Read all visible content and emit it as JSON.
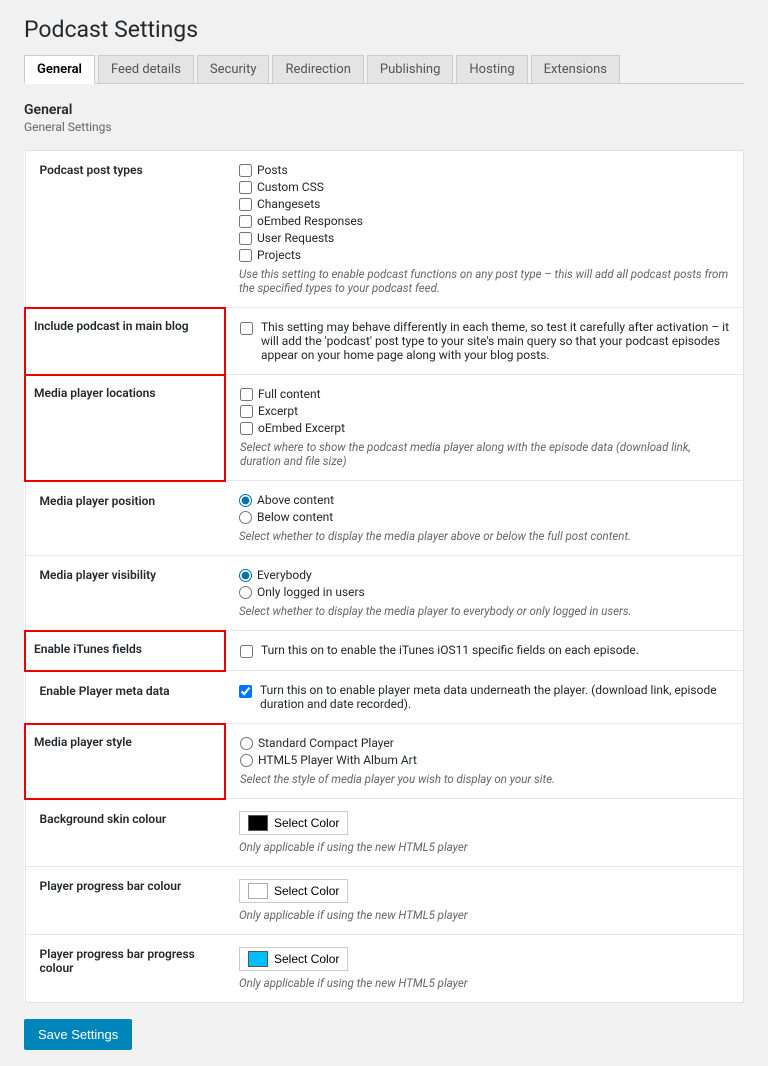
{
  "page": {
    "title": "Podcast Settings",
    "tabs": [
      {
        "label": "General",
        "active": true
      },
      {
        "label": "Feed details",
        "active": false
      },
      {
        "label": "Security",
        "active": false
      },
      {
        "label": "Redirection",
        "active": false
      },
      {
        "label": "Publishing",
        "active": false
      },
      {
        "label": "Hosting",
        "active": false
      },
      {
        "label": "Extensions",
        "active": false
      }
    ]
  },
  "section": {
    "title": "General",
    "subtitle": "General Settings"
  },
  "settings": {
    "podcast_post_types": {
      "label": "Podcast post types",
      "options": [
        "Posts",
        "Custom CSS",
        "Changesets",
        "oEmbed Responses",
        "User Requests",
        "Projects"
      ],
      "help": "Use this setting to enable podcast functions on any post type – this will add all podcast posts from the specified types to your podcast feed."
    },
    "include_podcast": {
      "label": "Include podcast in main blog",
      "help_text": "This setting may behave differently in each theme, so test it carefully after activation – it will add the 'podcast' post type to your site's main query so that your podcast episodes appear on your home page along with your blog posts.",
      "highlighted": true
    },
    "media_player_locations": {
      "label": "Media player locations",
      "options": [
        "Full content",
        "Excerpt",
        "oEmbed Excerpt"
      ],
      "help": "Select where to show the podcast media player along with the episode data (download link, duration and file size)",
      "highlighted": true
    },
    "media_player_position": {
      "label": "Media player position",
      "options": [
        "Above content",
        "Below content"
      ],
      "selected": "Above content",
      "help": "Select whether to display the media player above or below the full post content."
    },
    "media_player_visibility": {
      "label": "Media player visibility",
      "options": [
        "Everybody",
        "Only logged in users"
      ],
      "selected": "Everybody",
      "help": "Select whether to display the media player to everybody or only logged in users."
    },
    "enable_itunes": {
      "label": "Enable iTunes fields",
      "help_text": "Turn this on to enable the iTunes iOS11 specific fields on each episode.",
      "highlighted": true
    },
    "enable_player_meta": {
      "label": "Enable Player meta data",
      "help_text": "Turn this on to enable player meta data underneath the player. (download link, episode duration and date recorded).",
      "checked": true
    },
    "media_player_style": {
      "label": "Media player style",
      "options": [
        "Standard Compact Player",
        "HTML5 Player With Album Art"
      ],
      "help": "Select the style of media player you wish to display on your site.",
      "highlighted": true
    },
    "bg_skin_colour": {
      "label": "Background skin colour",
      "color": "#000000",
      "btn_label": "Select Color",
      "help": "Only applicable if using the new HTML5 player"
    },
    "progress_bar_colour": {
      "label": "Player progress bar colour",
      "color": "#ffffff",
      "btn_label": "Select Color",
      "help": "Only applicable if using the new HTML5 player"
    },
    "progress_bar_progress_colour": {
      "label": "Player progress bar progress colour",
      "color": "#00bfff",
      "btn_label": "Select Color",
      "help": "Only applicable if using the new HTML5 player"
    }
  },
  "buttons": {
    "save": "Save Settings"
  }
}
